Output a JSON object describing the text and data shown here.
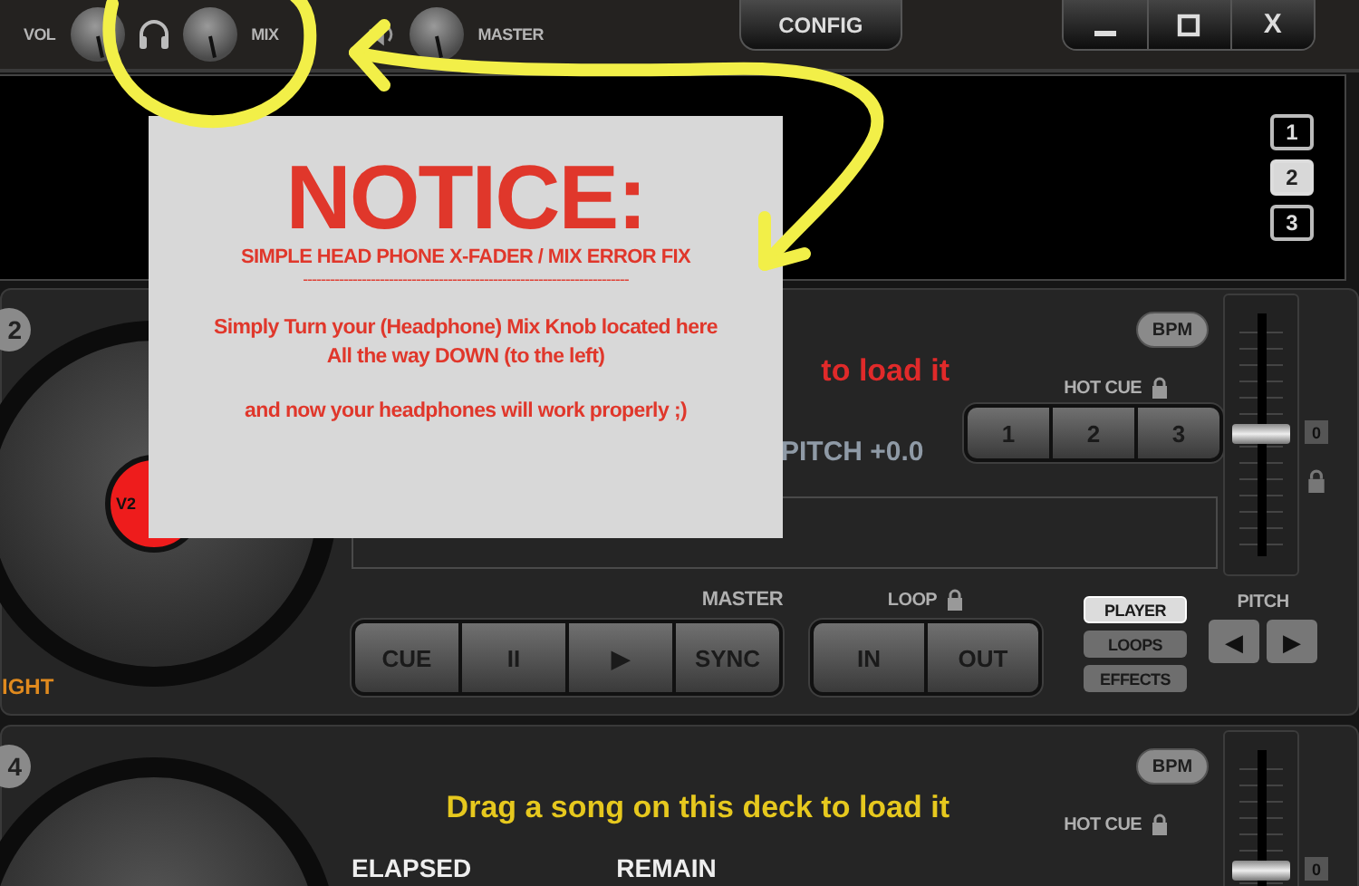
{
  "mixer": [
    {
      "kind": "plain",
      "label": "VOL"
    },
    {
      "kind": "headphone",
      "label": "MIX"
    },
    {
      "kind": "speaker",
      "label": "MASTER"
    }
  ],
  "config_button": "CONFIG",
  "close_button": "X",
  "deck_selector": [
    {
      "label": "1",
      "selected": false
    },
    {
      "label": "2",
      "selected": true
    },
    {
      "label": "3",
      "selected": false
    }
  ],
  "decks": [
    {
      "number": "2",
      "platter_label": "V2",
      "title": "to load it",
      "color": "#e02a2a",
      "pitch": "PITCH +0.0",
      "bpm": "BPM",
      "hot_cue_label": "HOT CUE",
      "hot_cues": [
        "1",
        "2",
        "3"
      ],
      "pitch_reset": "0",
      "level": 0.5,
      "deck_label": "IGHT",
      "master_label": "MASTER",
      "transport": [
        "CUE",
        "II",
        "▶",
        "SYNC"
      ],
      "loop_label": "LOOP",
      "loop_buttons": [
        "IN",
        "OUT"
      ],
      "views": [
        {
          "label": "PLAYER",
          "selected": true
        },
        {
          "label": "LOOPS",
          "selected": false
        },
        {
          "label": "EFFECTS",
          "selected": false
        }
      ],
      "pitch_label": "PITCH",
      "pitch_buttons": [
        "◀",
        "▶"
      ]
    },
    {
      "number": "4",
      "title": "Drag a song on this deck to load it",
      "color": "#e6c81e",
      "elapsed": "ELAPSED",
      "remain": "REMAIN",
      "bpm": "BPM",
      "hot_cue_label": "HOT CUE",
      "pitch_reset": "0",
      "level": 0.5
    }
  ],
  "notice": {
    "title": "NOTICE:",
    "subtitle": "SIMPLE HEAD PHONE X-FADER / MIX ERROR FIX",
    "rule": "------------------------------------------------------------------------",
    "paragraphs": [
      "Simply Turn your (Headphone) Mix Knob located here\nAll the way DOWN (to the left)",
      "and now your headphones will work properly ;)"
    ]
  }
}
